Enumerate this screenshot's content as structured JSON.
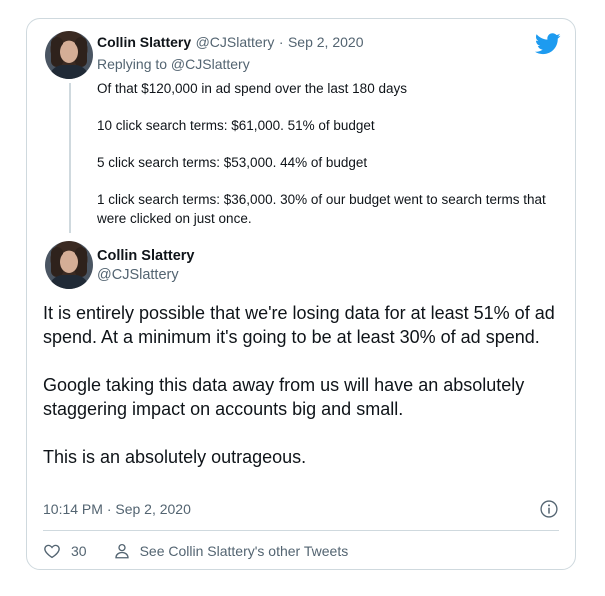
{
  "tweet1": {
    "name": "Collin Slattery",
    "handle": "@CJSlattery",
    "separator": "·",
    "date": "Sep 2, 2020",
    "replying_to": "Replying to @CJSlattery",
    "paragraphs": [
      "Of that $120,000 in ad spend over the last 180 days",
      "10 click search terms: $61,000. 51% of budget",
      "5 click search terms: $53,000. 44% of budget",
      "1 click search terms: $36,000. 30% of our budget went to search terms that were clicked on just once."
    ]
  },
  "tweet2": {
    "name": "Collin Slattery",
    "handle": "@CJSlattery",
    "paragraphs": [
      "It is entirely possible that we're losing data for at least 51% of ad spend. At a minimum it's going to be at least 30% of ad spend.",
      "Google taking this data away from us will have an absolutely staggering impact on accounts big and small.",
      "This is an absolutely outrageous."
    ],
    "timestamp": "10:14 PM · Sep 2, 2020"
  },
  "actions": {
    "like_count": "30",
    "other_tweets_label": "See Collin Slattery's other Tweets"
  },
  "icons": {
    "brand": "twitter-bird-icon",
    "info": "info-icon",
    "like": "heart-icon",
    "profile": "person-icon"
  },
  "colors": {
    "twitter_blue": "#1d9bf0",
    "muted_text": "#536471",
    "border": "#cfd9de"
  }
}
